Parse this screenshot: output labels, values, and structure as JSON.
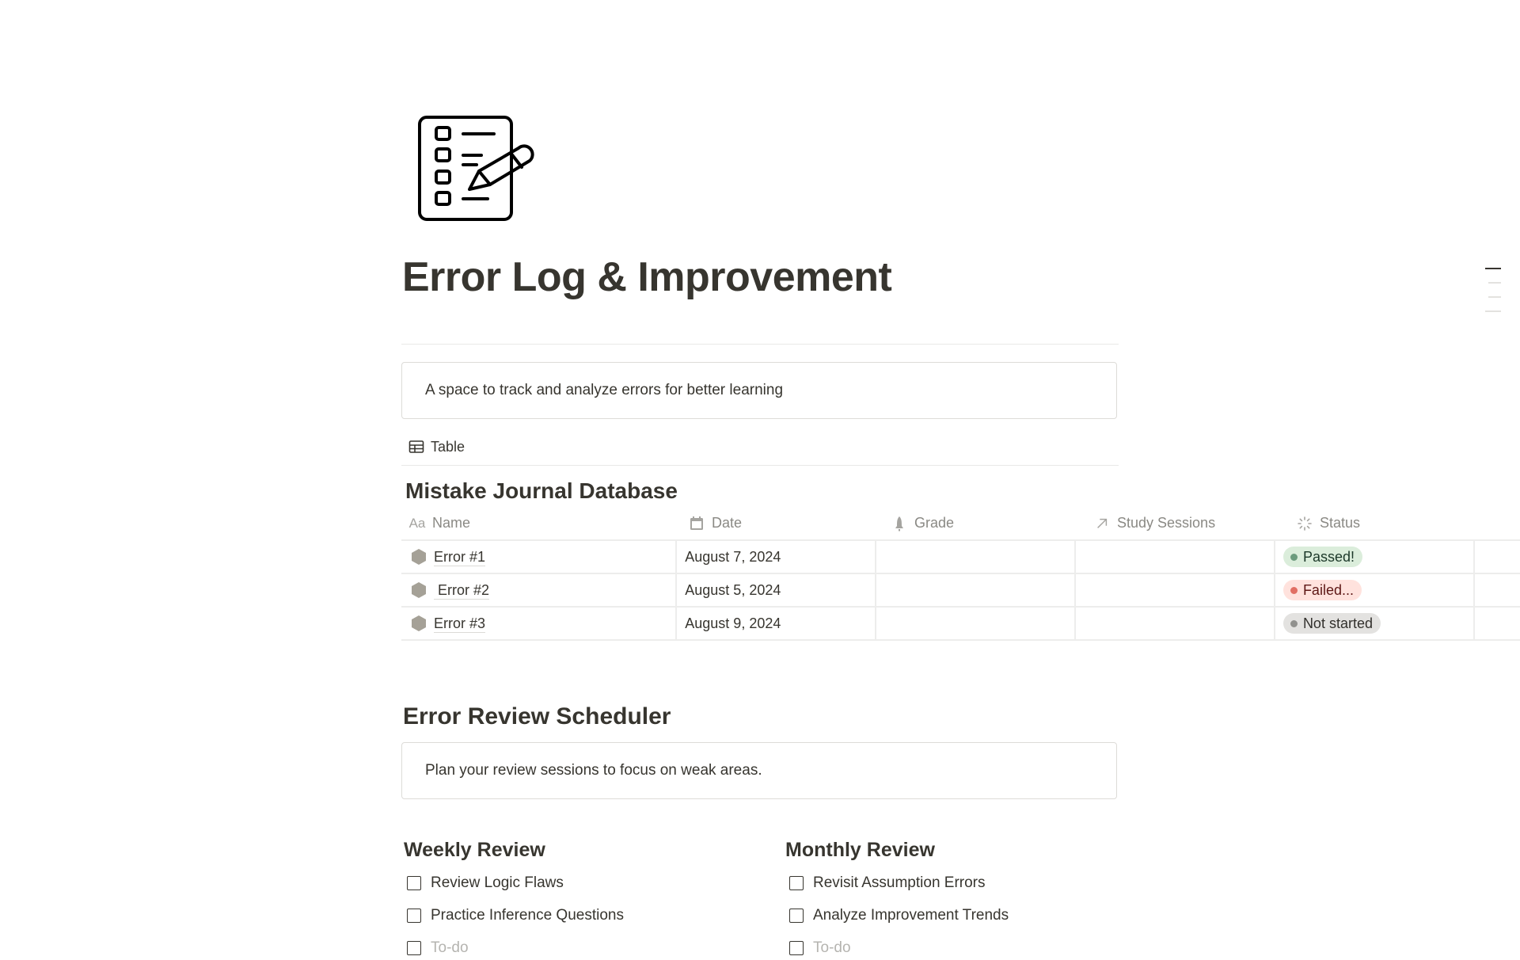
{
  "page": {
    "icon": "checklist-pencil-icon",
    "title": "Error Log & Improvement",
    "description": "A space to track and analyze errors for better learning"
  },
  "outline": {
    "items": [
      "Error Log & Improvement",
      "Mistake Journal Database",
      "Error Review Scheduler",
      "Weekly Review"
    ]
  },
  "database": {
    "view_tab": {
      "icon": "table-icon",
      "label": "Table"
    },
    "title": "Mistake Journal Database",
    "columns": [
      {
        "icon": "text-aa-icon",
        "label": "Name"
      },
      {
        "icon": "calendar-icon",
        "label": "Date"
      },
      {
        "icon": "rocket-icon",
        "label": "Grade"
      },
      {
        "icon": "relation-arrow-icon",
        "label": "Study Sessions"
      },
      {
        "icon": "status-spinner-icon",
        "label": "Status"
      }
    ],
    "rows": [
      {
        "name": "Error #1",
        "date": "August 7, 2024",
        "grade": "",
        "study_sessions": "",
        "status": "Passed!"
      },
      {
        "name": " Error #2",
        "date": "August 5, 2024",
        "grade": "",
        "study_sessions": "",
        "status": "Failed..."
      },
      {
        "name": "Error #3",
        "date": "August 9, 2024",
        "grade": "",
        "study_sessions": "",
        "status": "Not started"
      }
    ],
    "status_colors": {
      "Passed!": {
        "bg": "#dbeddb",
        "dot": "#6c9b7d",
        "text": "#1c3829"
      },
      "Failed...": {
        "bg": "#ffe2dd",
        "dot": "#e16f64",
        "text": "#5d1715"
      },
      "Not started": {
        "bg": "#e3e2e0",
        "dot": "#91918e",
        "text": "#32302c"
      }
    }
  },
  "scheduler": {
    "title": "Error Review Scheduler",
    "description": "Plan your review sessions to focus on weak areas.",
    "weekly": {
      "title": "Weekly Review",
      "items": [
        {
          "label": "Review Logic Flaws",
          "checked": false
        },
        {
          "label": "Practice Inference Questions",
          "checked": false
        }
      ],
      "placeholder": "To-do"
    },
    "monthly": {
      "title": "Monthly Review",
      "items": [
        {
          "label": "Revisit Assumption Errors",
          "checked": false
        },
        {
          "label": "Analyze Improvement Trends",
          "checked": false
        }
      ],
      "placeholder": "To-do"
    }
  }
}
